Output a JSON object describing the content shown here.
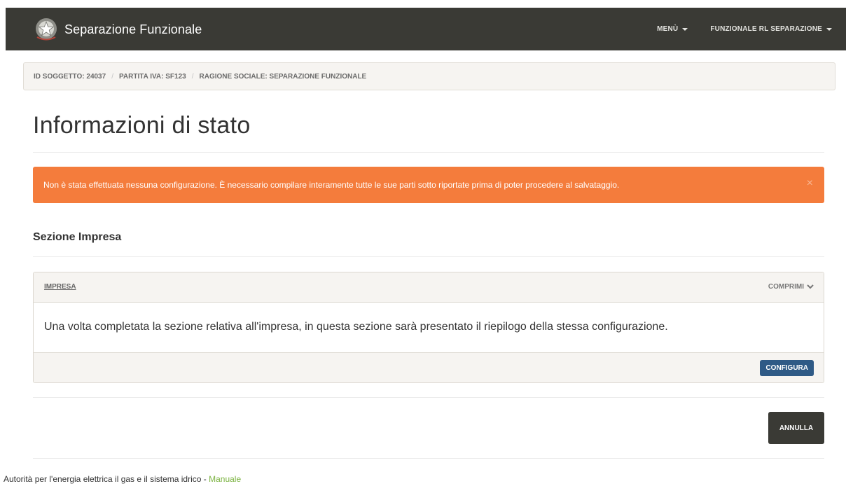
{
  "navbar": {
    "brand_title": "Separazione Funzionale",
    "menu_items": [
      {
        "label": "MENÙ"
      },
      {
        "label": "FUNZIONALE RL SEPARAZIONE"
      }
    ]
  },
  "breadcrumb": {
    "items": [
      "ID SOGGETTO: 24037",
      "PARTITA IVA: SF123",
      "RAGIONE SOCIALE: SEPARAZIONE FUNZIONALE"
    ],
    "separator": "/"
  },
  "page": {
    "title": "Informazioni di stato"
  },
  "alert": {
    "message": "Non è stata effettuata nessuna configurazione. È necessario compilare interamente tutte le sue parti sotto riportate prima di poter procedere al salvataggio.",
    "close_symbol": "×",
    "color": "#f47c3c"
  },
  "section": {
    "title": "Sezione Impresa"
  },
  "panel": {
    "title": "IMPRESA",
    "toggle_label": "COMPRIMI",
    "body_text": "Una volta completata la sezione relativa all'impresa, in questa sezione sarà presentato il riepilogo della stessa configurazione.",
    "configure_label": "CONFIGURA"
  },
  "actions": {
    "cancel_label": "ANNULLA"
  },
  "footer": {
    "text": "Autorità per l'energia elettrica il gas e il sistema idrico - ",
    "link_label": "Manuale"
  },
  "colors": {
    "navbar": "#3a3a35",
    "accent_button": "#2f5a86",
    "link": "#7cb342"
  }
}
